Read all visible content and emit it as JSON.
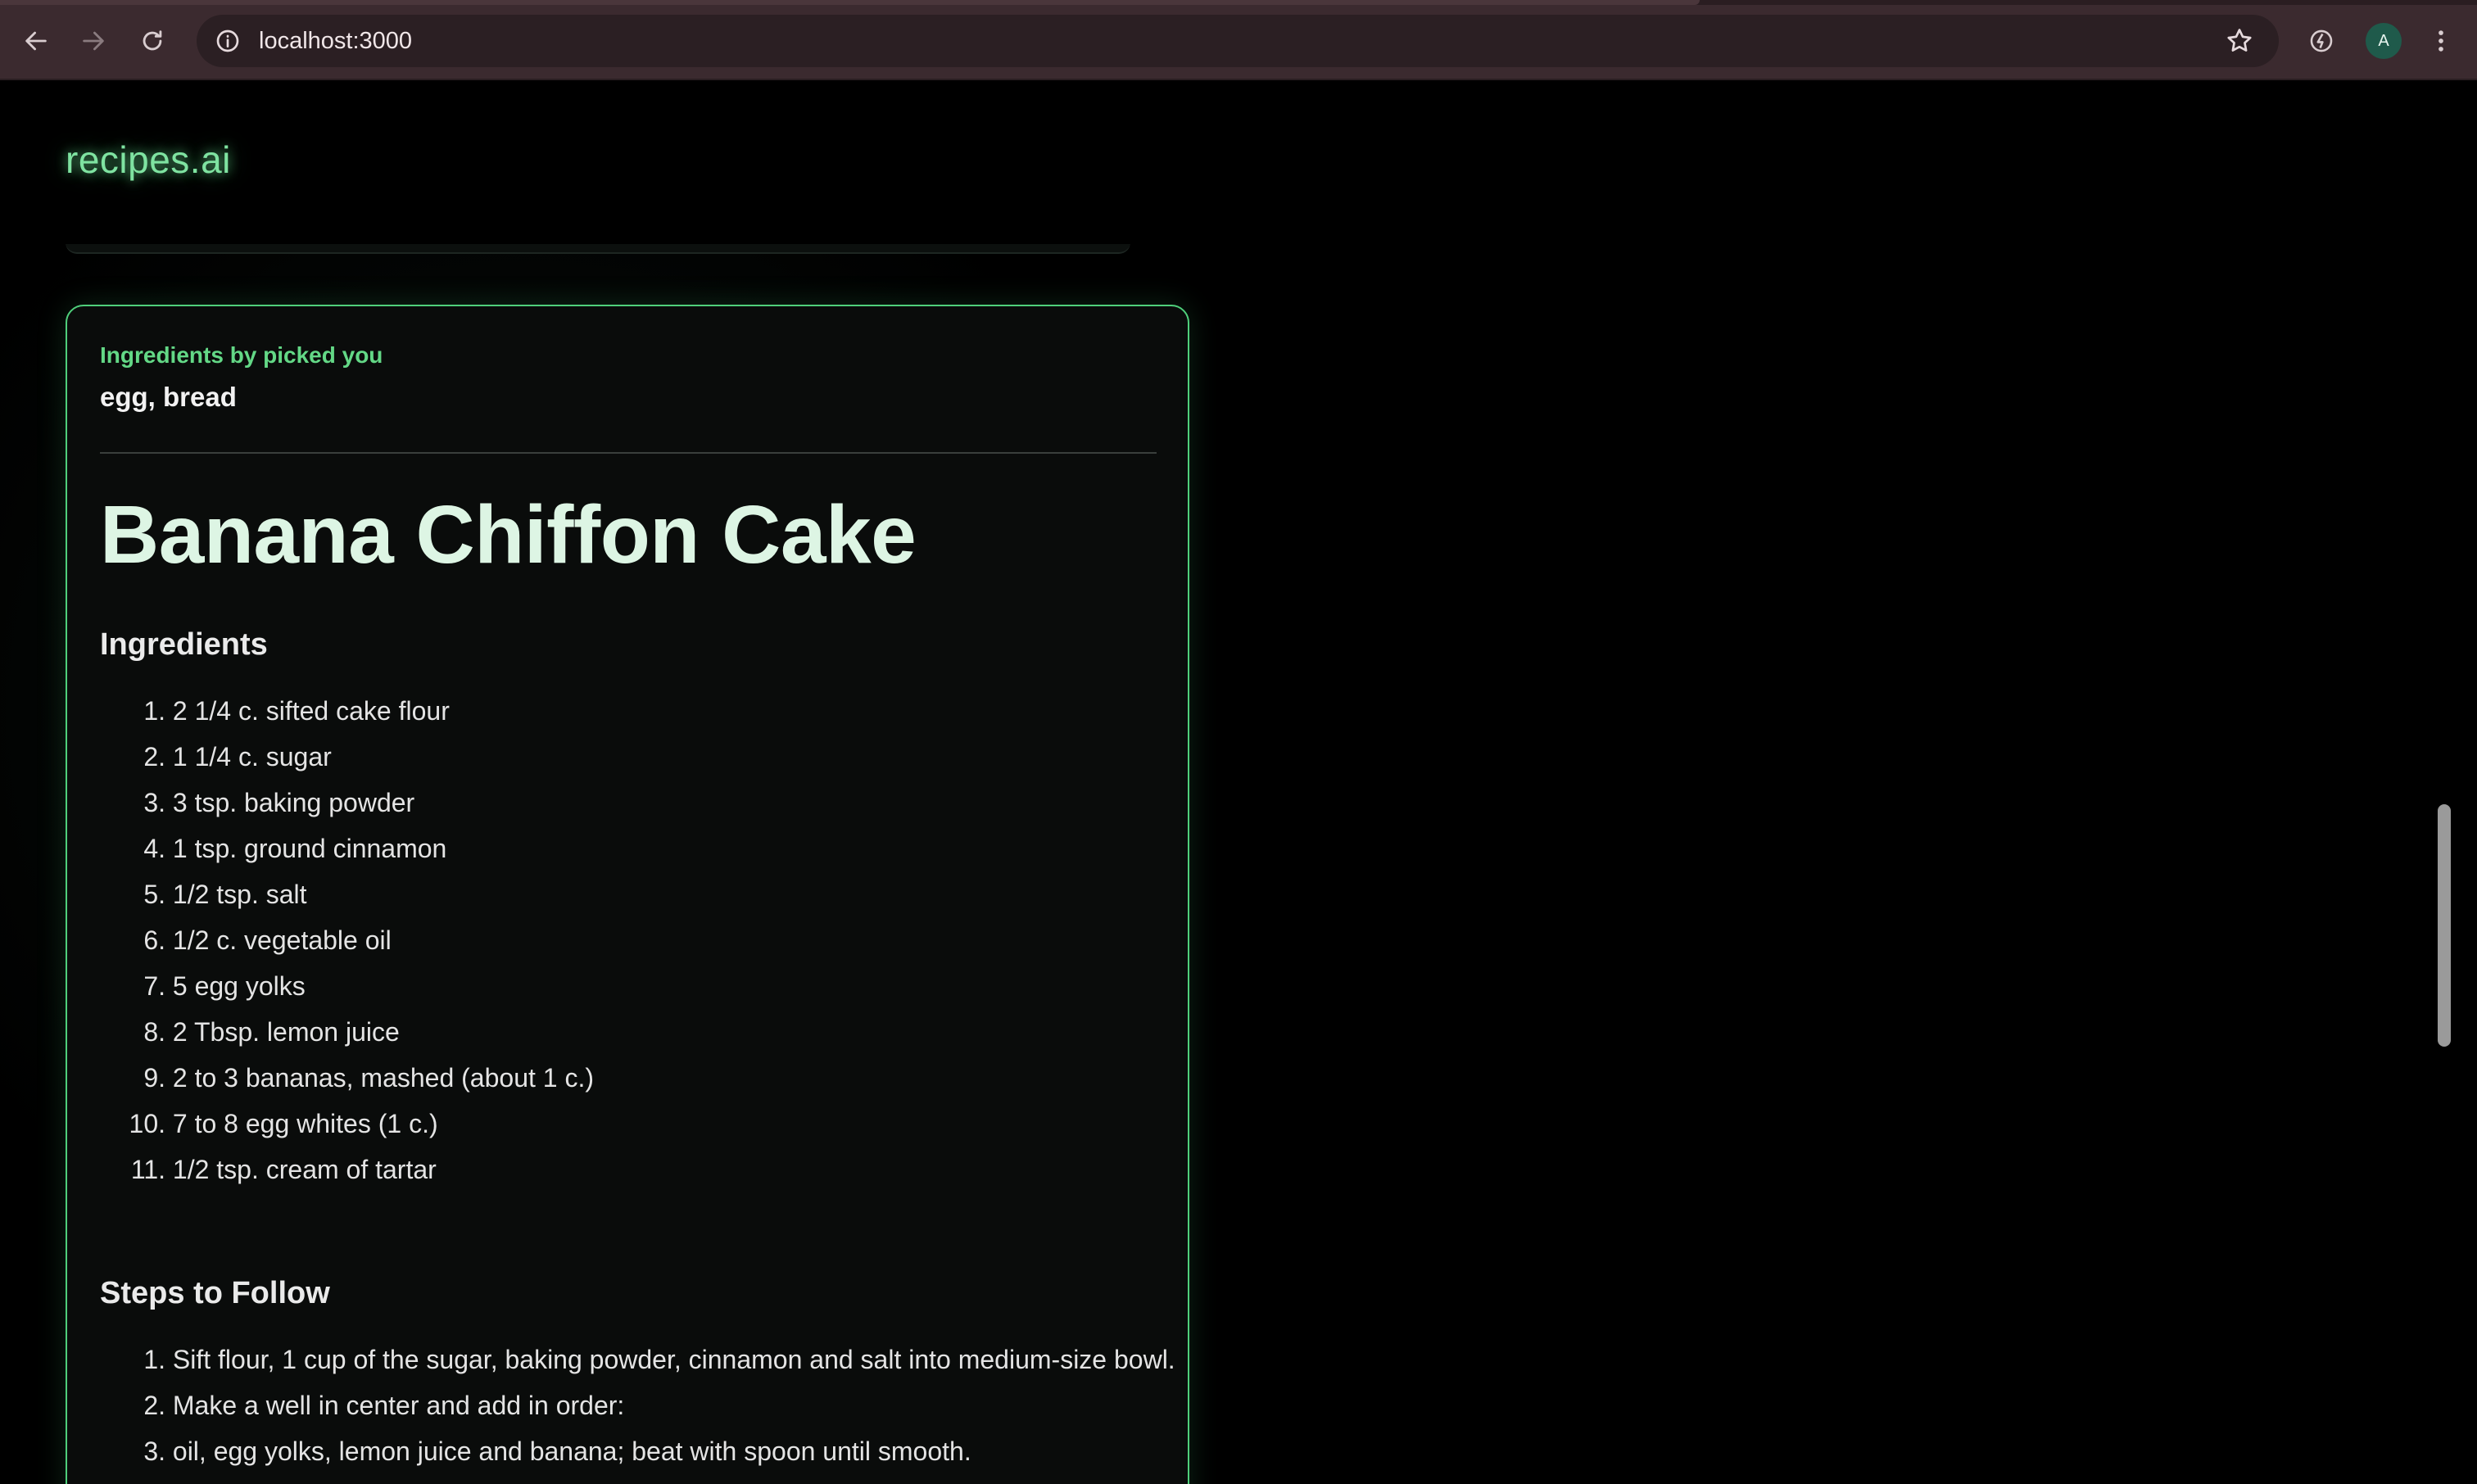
{
  "browser": {
    "url": "localhost:3000",
    "avatar_letter": "A",
    "icons": {
      "back": "arrow-left-icon",
      "forward": "arrow-right-icon",
      "reload": "reload-icon",
      "site_info": "info-icon",
      "bookmark": "star-icon",
      "extension": "extension-icon",
      "menu": "kebab-menu-icon"
    }
  },
  "site": {
    "logo": "recipes.ai",
    "accent_color": "#4fcf7b"
  },
  "recipe_card": {
    "picked_label": "Ingredients by picked you",
    "picked_values": "egg, bread",
    "title": "Banana Chiffon Cake",
    "ingredients_heading": "Ingredients",
    "ingredients": [
      {
        "num": "1.",
        "text": "2 1/4 c. sifted cake flour"
      },
      {
        "num": "2.",
        "text": "1 1/4 c. sugar"
      },
      {
        "num": "3.",
        "text": "3 tsp. baking powder"
      },
      {
        "num": "4.",
        "text": "1 tsp. ground cinnamon"
      },
      {
        "num": "5.",
        "text": "1/2 tsp. salt"
      },
      {
        "num": "6.",
        "text": "1/2 c. vegetable oil"
      },
      {
        "num": "7.",
        "text": "5 egg yolks"
      },
      {
        "num": "8.",
        "text": "2 Tbsp. lemon juice"
      },
      {
        "num": "9.",
        "text": "2 to 3 bananas, mashed (about 1 c.)"
      },
      {
        "num": "10.",
        "text": "7 to 8 egg whites (1 c.)"
      },
      {
        "num": "11.",
        "text": "1/2 tsp. cream of tartar"
      }
    ],
    "steps_heading": "Steps to Follow",
    "steps": [
      {
        "num": "1.",
        "text": "Sift flour, 1 cup of the sugar, baking powder, cinnamon and salt into medium-size bowl."
      },
      {
        "num": "2.",
        "text": "Make a well in center and add in order:"
      },
      {
        "num": "3.",
        "text": "oil, egg yolks, lemon juice and banana; beat with spoon until smooth."
      }
    ]
  }
}
